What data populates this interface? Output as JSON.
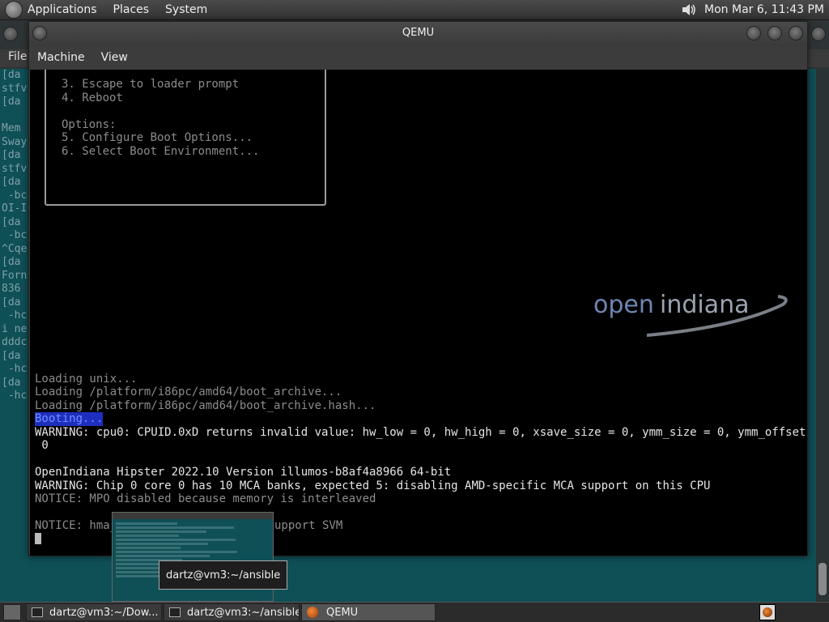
{
  "top_panel": {
    "menus": [
      "Applications",
      "Places",
      "System"
    ],
    "clock": "Mon Mar  6, 11:43 PM"
  },
  "bg_terminal": {
    "menu_label": "File",
    "lines": [
      "[da",
      "stfv",
      "[da",
      "",
      "Mem",
      "Sway",
      "[da",
      "stfv",
      "[da",
      " -bc",
      "OI-I",
      "[da",
      " -bc",
      "^Cqe",
      "[da",
      "Forn",
      "836",
      "[da",
      " -hc",
      "i ne",
      "dddc",
      "[da",
      " -hc",
      "[da",
      " -hc"
    ]
  },
  "qemu": {
    "title": "QEMU",
    "menus": [
      "Machine",
      "View"
    ],
    "boot_menu": {
      "items": [
        "3. Escape to loader prompt",
        "4. Reboot"
      ],
      "options_header": "Options:",
      "options": [
        "5. Configure Boot Options...",
        "6. Select Boot Environment..."
      ]
    },
    "logo": {
      "open": "open",
      "indiana": "indiana",
      "color": "#6f86b3"
    },
    "console": {
      "loading": [
        "Loading unix...",
        "Loading /platform/i86pc/amd64/boot_archive...",
        "Loading /platform/i86pc/amd64/boot_archive.hash..."
      ],
      "booting": "Booting...",
      "warning_cpu": "WARNING: cpu0: CPUID.0xD returns invalid value: hw_low = 0, hw_high = 0, xsave_size = 0, ymm_size = 0, ymm_offset =",
      "warning_cpu_cont": " 0",
      "version": "OpenIndiana Hipster 2022.10 Version illumos-b8af4a8966 64-bit",
      "warning_mca": "WARNING: Chip 0 core 0 has 10 MCA banks, expected 5: disabling AMD-specific MCA support on this CPU",
      "notice_mpo": "NOTICE: MPO disabled because memory is interleaved",
      "notice_hma_start": "NOTICE: hma_",
      "notice_hma_end": "upport SVM"
    }
  },
  "taskbar": {
    "tasks": [
      {
        "label": "dartz@vm3:~/Dow..."
      },
      {
        "label": "dartz@vm3:~/ansible"
      },
      {
        "label": "QEMU"
      }
    ]
  },
  "tooltip": "dartz@vm3:~/ansible"
}
